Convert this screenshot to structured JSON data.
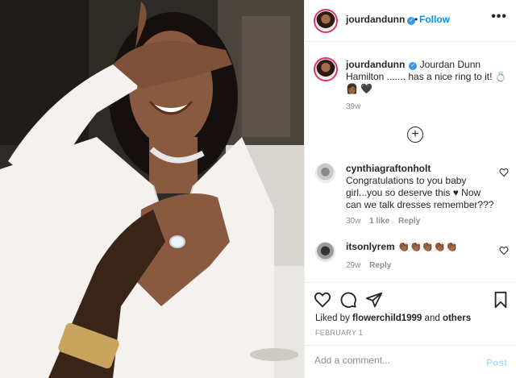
{
  "post": {
    "username": "jourdandunn",
    "follow_label": "Follow",
    "dot": "•",
    "more": "•••",
    "caption_text": "Jourdan Dunn Hamilton ....... has a nice ring to it! 💍👩🏾 🖤",
    "caption_time": "39w"
  },
  "comments": [
    {
      "username": "cynthiagraftonholt",
      "text": "Congratulations to you baby girl...you so deserve this ♥ Now can we talk dresses remember???",
      "time": "30w",
      "likes": "1 like",
      "reply": "Reply"
    },
    {
      "username": "itsonlyrem",
      "text": "👏🏾👏🏾👏🏾👏🏾👏🏾",
      "time": "29w",
      "reply": "Reply"
    }
  ],
  "footer": {
    "liked_prefix": "Liked by",
    "liked_user": "flowerchild1999",
    "liked_and": "and",
    "liked_others": "others",
    "date": "FEBRUARY 1",
    "comment_placeholder": "Add a comment...",
    "post_label": "Post"
  },
  "icons": {
    "verified": "verified-badge-icon",
    "load_more": "plus-circle-icon",
    "like": "heart-icon",
    "comment": "comment-bubble-icon",
    "share": "paper-plane-icon",
    "save": "bookmark-icon"
  },
  "colors": {
    "accent": "#0095f6",
    "verified": "#3897f0",
    "muted": "#8e8e8e",
    "post_disabled": "#b2dffc"
  }
}
